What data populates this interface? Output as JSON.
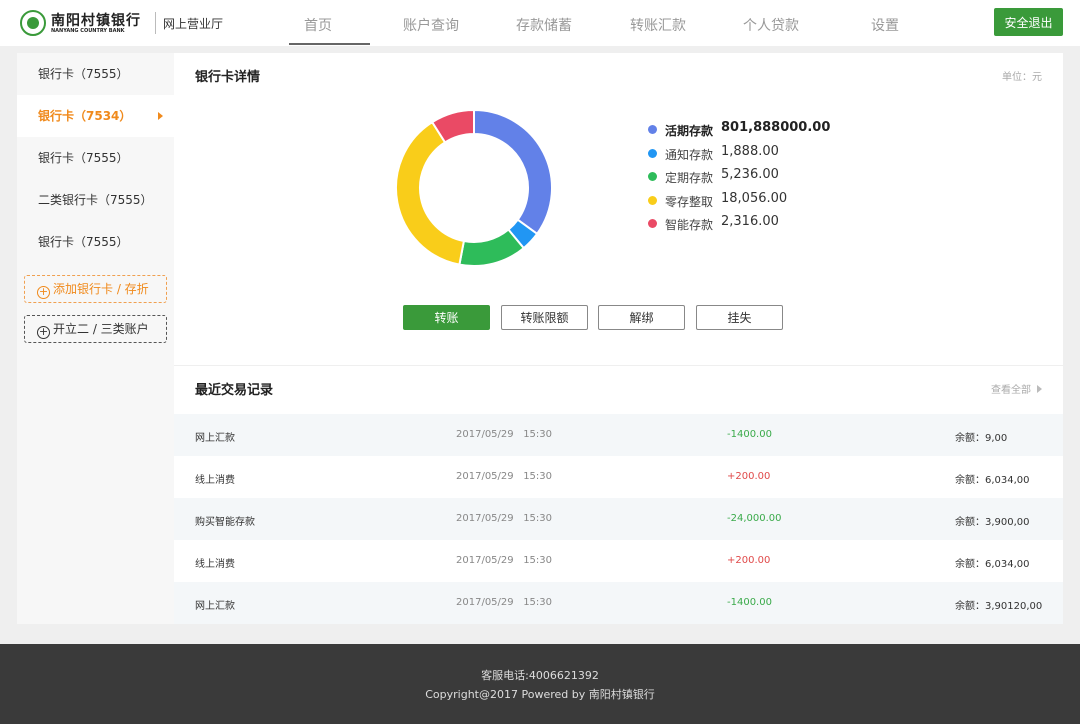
{
  "header": {
    "bank_name": "南阳村镇银行",
    "bank_name_en": "NANYANG COUNTRY BANK",
    "portal": "网上营业厅",
    "nav": [
      "首页",
      "账户查询",
      "存款储蓄",
      "转账汇款",
      "个人贷款",
      "设置"
    ],
    "active_nav": "首页",
    "logout": "安全退出"
  },
  "sidebar": {
    "items": [
      "银行卡（7555）",
      "银行卡（7534）",
      "银行卡（7555）",
      "二类银行卡（7555）",
      "银行卡（7555）"
    ],
    "active_index": 1,
    "add_card": "添加银行卡 / 存折",
    "open_account": "开立二 / 三类账户"
  },
  "detail": {
    "title": "银行卡详情",
    "unit": "单位：元",
    "actions": [
      "转账",
      "转账限额",
      "解绑",
      "挂失"
    ]
  },
  "chart_data": {
    "type": "pie",
    "categories": [
      "活期存款",
      "通知存款",
      "定期存款",
      "零存整取",
      "智能存款"
    ],
    "values": [
      "801,888000.00",
      "1,888.00",
      "5,236.00",
      "18,056.00",
      "2,316.00"
    ],
    "slice_percent": [
      35,
      4,
      14,
      38,
      9
    ],
    "colors": [
      "#6281e8",
      "#2196f3",
      "#2ebc5a",
      "#f9cd1a",
      "#ea4a65"
    ],
    "legend_position": "right"
  },
  "transactions": {
    "title": "最近交易记录",
    "view_all": "查看全部",
    "rows": [
      {
        "name": "网上汇款",
        "date": "2017/05/29",
        "time": "15:30",
        "amount": "-1400.00",
        "balance": "余额：9,00"
      },
      {
        "name": "线上消费",
        "date": "2017/05/29",
        "time": "15:30",
        "amount": "+200.00",
        "balance": "余额：6,034,00"
      },
      {
        "name": "购买智能存款",
        "date": "2017/05/29",
        "time": "15:30",
        "amount": "-24,000.00",
        "balance": "余额：3,900,00"
      },
      {
        "name": "线上消费",
        "date": "2017/05/29",
        "time": "15:30",
        "amount": "+200.00",
        "balance": "余额：6,034,00"
      },
      {
        "name": "网上汇款",
        "date": "2017/05/29",
        "time": "15:30",
        "amount": "-1400.00",
        "balance": "余额：3,90120,00"
      }
    ]
  },
  "footer": {
    "phone": "客服电话:4006621392",
    "copyright": "Copyright@2017 Powered by 南阳村镇银行"
  }
}
